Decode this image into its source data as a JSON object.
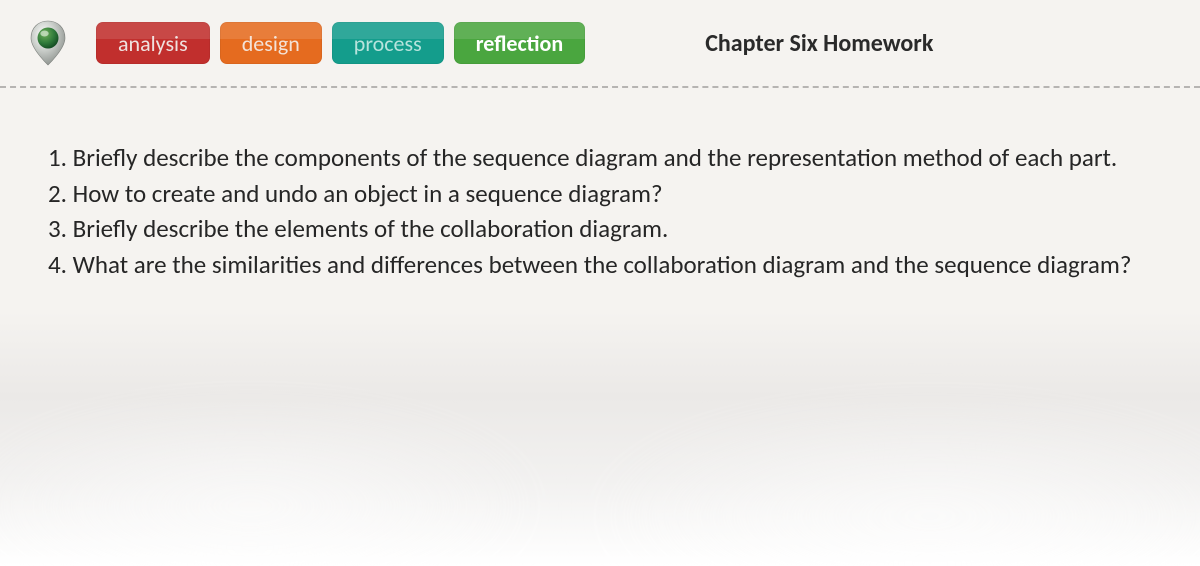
{
  "header": {
    "tabs": [
      {
        "id": "analysis",
        "label": "analysis"
      },
      {
        "id": "design",
        "label": "design"
      },
      {
        "id": "process",
        "label": "process"
      },
      {
        "id": "reflection",
        "label": "reflection"
      }
    ],
    "title": "Chapter Six Homework"
  },
  "questions": [
    "1. Briefly describe the components of the sequence diagram and the representation method of each part.",
    "2. How to create and undo an object in a sequence diagram?",
    "3. Briefly describe the elements of the collaboration diagram.",
    "4. What are the similarities and differences between the collaboration diagram and the sequence diagram?"
  ]
}
